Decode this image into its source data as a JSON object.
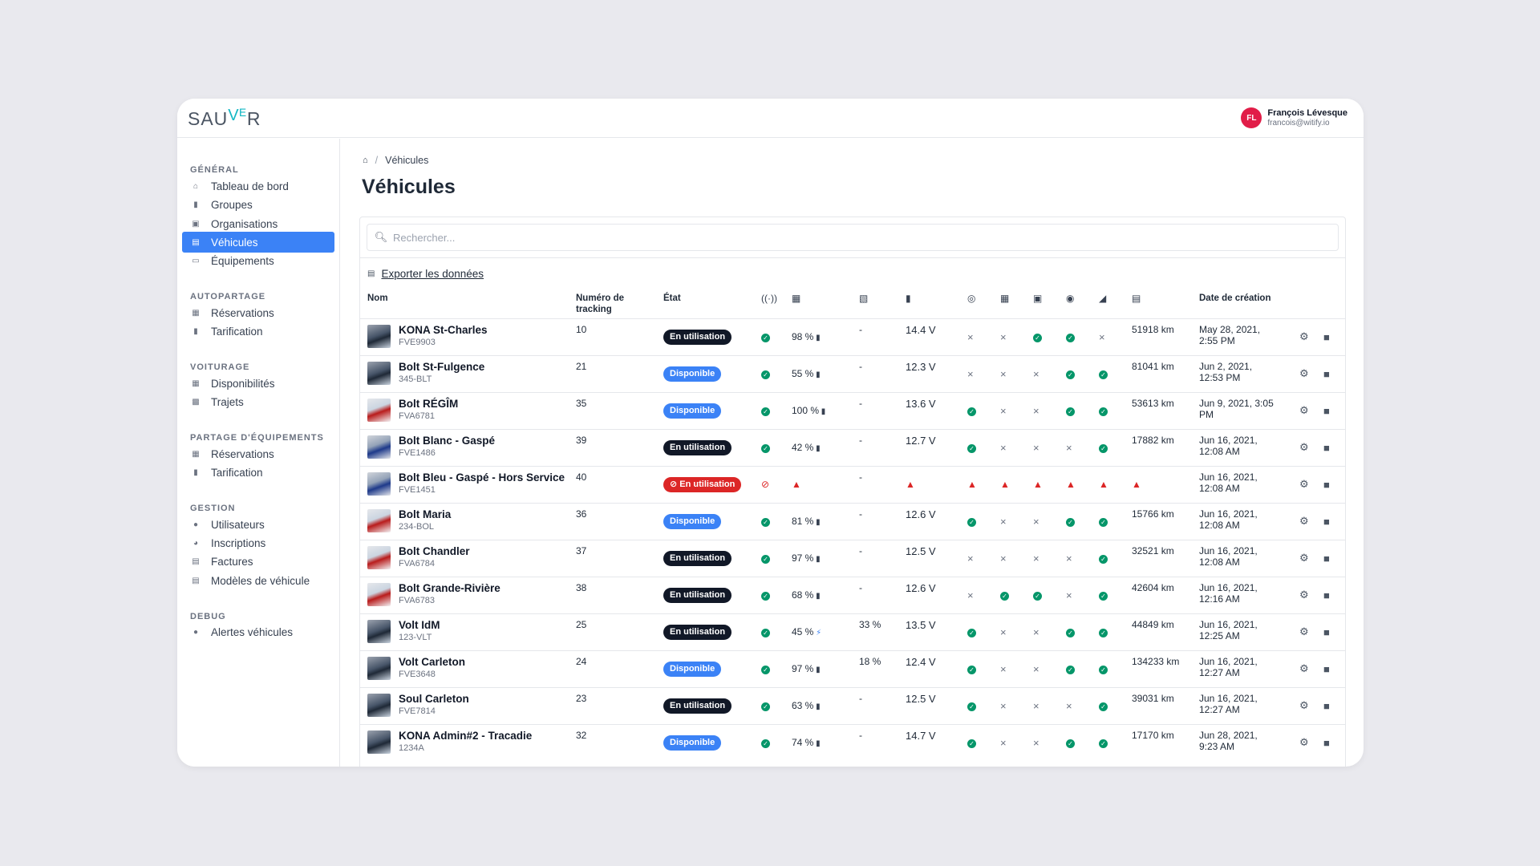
{
  "brand": {
    "logo_left": "SAU",
    "logo_accent": "Vᴱ",
    "logo_right": "R"
  },
  "user": {
    "initials": "FL",
    "name": "François Lévesque",
    "email": "francois@witify.io"
  },
  "sidebar": {
    "sections": [
      {
        "title": "GÉNÉRAL",
        "items": [
          {
            "label": "Tableau de bord",
            "icon": "home-icon"
          },
          {
            "label": "Groupes",
            "icon": "folder-icon"
          },
          {
            "label": "Organisations",
            "icon": "building-icon"
          },
          {
            "label": "Véhicules",
            "icon": "car-icon",
            "active": true
          },
          {
            "label": "Équipements",
            "icon": "tools-icon"
          }
        ]
      },
      {
        "title": "AUTOPARTAGE",
        "items": [
          {
            "label": "Réservations",
            "icon": "calendar-icon"
          },
          {
            "label": "Tarification",
            "icon": "receipt-icon"
          }
        ]
      },
      {
        "title": "VOITURAGE",
        "items": [
          {
            "label": "Disponibilités",
            "icon": "calendar-icon"
          },
          {
            "label": "Trajets",
            "icon": "route-icon"
          }
        ]
      },
      {
        "title": "PARTAGE D'ÉQUIPEMENTS",
        "items": [
          {
            "label": "Réservations",
            "icon": "calendar-icon"
          },
          {
            "label": "Tarification",
            "icon": "receipt-icon"
          }
        ]
      },
      {
        "title": "GESTION",
        "items": [
          {
            "label": "Utilisateurs",
            "icon": "users-icon"
          },
          {
            "label": "Inscriptions",
            "icon": "user-plus-icon"
          },
          {
            "label": "Factures",
            "icon": "invoice-icon"
          },
          {
            "label": "Modèles de véhicule",
            "icon": "car-model-icon"
          }
        ]
      },
      {
        "title": "DEBUG",
        "items": [
          {
            "label": "Alertes véhicules",
            "icon": "alert-dot-icon"
          }
        ]
      }
    ]
  },
  "breadcrumb": {
    "current": "Véhicules"
  },
  "page": {
    "title": "Véhicules"
  },
  "search": {
    "placeholder": "Rechercher..."
  },
  "export": {
    "label": "Exporter les données"
  },
  "table": {
    "headers": {
      "name": "Nom",
      "tracking_line1": "Numéro de",
      "tracking_line2": "tracking",
      "state": "État",
      "created": "Date de création"
    },
    "rows": [
      {
        "name": "KONA St-Charles",
        "code": "FVE9903",
        "tracking": "10",
        "state": "En utilisation",
        "state_kind": "use",
        "signal": "ok",
        "charge": "98 %",
        "fuel": "-",
        "voltage": "14.4 V",
        "c1": "no",
        "c2": "no",
        "c3": "ok",
        "c4": "ok",
        "c5": "no",
        "km": "51918 km",
        "date1": "May 28, 2021,",
        "date2": "2:55 PM",
        "thumb": "dark"
      },
      {
        "name": "Bolt St-Fulgence",
        "code": "345-BLT",
        "tracking": "21",
        "state": "Disponible",
        "state_kind": "dispo",
        "signal": "ok",
        "charge": "55 %",
        "fuel": "-",
        "voltage": "12.3 V",
        "c1": "no",
        "c2": "no",
        "c3": "no",
        "c4": "ok",
        "c5": "ok",
        "km": "81041 km",
        "date1": "Jun 2, 2021,",
        "date2": "12:53 PM",
        "thumb": "dark"
      },
      {
        "name": "Bolt RÉGÎM",
        "code": "FVA6781",
        "tracking": "35",
        "state": "Disponible",
        "state_kind": "dispo",
        "signal": "ok",
        "charge": "100 %",
        "fuel": "-",
        "voltage": "13.6 V",
        "c1": "ok",
        "c2": "no",
        "c3": "no",
        "c4": "ok",
        "c5": "ok",
        "km": "53613 km",
        "date1": "Jun 9, 2021, 3:05",
        "date2": "PM",
        "thumb": "red"
      },
      {
        "name": "Bolt Blanc - Gaspé",
        "code": "FVE1486",
        "tracking": "39",
        "state": "En utilisation",
        "state_kind": "use",
        "signal": "ok",
        "charge": "42 %",
        "fuel": "-",
        "voltage": "12.7 V",
        "c1": "ok",
        "c2": "no",
        "c3": "no",
        "c4": "no",
        "c5": "ok",
        "km": "17882 km",
        "date1": "Jun 16, 2021,",
        "date2": "12:08 AM",
        "thumb": "blue"
      },
      {
        "name": "Bolt Bleu - Gaspé - Hors Service",
        "code": "FVE1451",
        "tracking": "40",
        "state": "En utilisation",
        "state_kind": "alert",
        "signal": "off",
        "charge": "",
        "fuel": "-",
        "voltage": "",
        "c1": "warn",
        "c2": "warn",
        "c3": "warn",
        "c4": "warn",
        "c5": "warn",
        "km": "",
        "date1": "Jun 16, 2021,",
        "date2": "12:08 AM",
        "thumb": "blue",
        "hors_service": true
      },
      {
        "name": "Bolt Maria",
        "code": "234-BOL",
        "tracking": "36",
        "state": "Disponible",
        "state_kind": "dispo",
        "signal": "ok",
        "charge": "81 %",
        "fuel": "-",
        "voltage": "12.6 V",
        "c1": "ok",
        "c2": "no",
        "c3": "no",
        "c4": "ok",
        "c5": "ok",
        "km": "15766 km",
        "date1": "Jun 16, 2021,",
        "date2": "12:08 AM",
        "thumb": "red"
      },
      {
        "name": "Bolt Chandler",
        "code": "FVA6784",
        "tracking": "37",
        "state": "En utilisation",
        "state_kind": "use",
        "signal": "ok",
        "charge": "97 %",
        "fuel": "-",
        "voltage": "12.5 V",
        "c1": "no",
        "c2": "no",
        "c3": "no",
        "c4": "no",
        "c5": "ok",
        "km": "32521 km",
        "date1": "Jun 16, 2021,",
        "date2": "12:08 AM",
        "thumb": "red"
      },
      {
        "name": "Bolt Grande-Rivière",
        "code": "FVA6783",
        "tracking": "38",
        "state": "En utilisation",
        "state_kind": "use",
        "signal": "ok",
        "charge": "68 %",
        "fuel": "-",
        "voltage": "12.6 V",
        "c1": "no",
        "c2": "ok",
        "c3": "ok",
        "c4": "no",
        "c5": "ok",
        "km": "42604 km",
        "date1": "Jun 16, 2021,",
        "date2": "12:16 AM",
        "thumb": "red"
      },
      {
        "name": "Volt IdM",
        "code": "123-VLT",
        "tracking": "25",
        "state": "En utilisation",
        "state_kind": "use",
        "signal": "ok",
        "charge": "45 %",
        "fuel": "33 %",
        "voltage": "13.5 V",
        "c1": "ok",
        "c2": "no",
        "c3": "no",
        "c4": "ok",
        "c5": "ok",
        "km": "44849 km",
        "date1": "Jun 16, 2021,",
        "date2": "12:25 AM",
        "thumb": "dark",
        "charging": true
      },
      {
        "name": "Volt Carleton",
        "code": "FVE3648",
        "tracking": "24",
        "state": "Disponible",
        "state_kind": "dispo",
        "signal": "ok",
        "charge": "97 %",
        "fuel": "18 %",
        "voltage": "12.4 V",
        "c1": "ok",
        "c2": "no",
        "c3": "no",
        "c4": "ok",
        "c5": "ok",
        "km": "134233 km",
        "date1": "Jun 16, 2021,",
        "date2": "12:27 AM",
        "thumb": "dark"
      },
      {
        "name": "Soul Carleton",
        "code": "FVE7814",
        "tracking": "23",
        "state": "En utilisation",
        "state_kind": "use",
        "signal": "ok",
        "charge": "63 %",
        "fuel": "-",
        "voltage": "12.5 V",
        "c1": "ok",
        "c2": "no",
        "c3": "no",
        "c4": "no",
        "c5": "ok",
        "km": "39031 km",
        "date1": "Jun 16, 2021,",
        "date2": "12:27 AM",
        "thumb": "dark"
      },
      {
        "name": "KONA Admin#2 - Tracadie",
        "code": "1234A",
        "tracking": "32",
        "state": "Disponible",
        "state_kind": "dispo",
        "signal": "ok",
        "charge": "74 %",
        "fuel": "-",
        "voltage": "14.7 V",
        "c1": "ok",
        "c2": "no",
        "c3": "no",
        "c4": "ok",
        "c5": "ok",
        "km": "17170 km",
        "date1": "Jun 28, 2021,",
        "date2": "9:23 AM",
        "thumb": "dark"
      }
    ]
  },
  "colors": {
    "accent": "#3b82f6",
    "ok": "#059669",
    "alert": "#dc2626",
    "dark_badge": "#111827",
    "logo_accent": "#14b8c4"
  }
}
